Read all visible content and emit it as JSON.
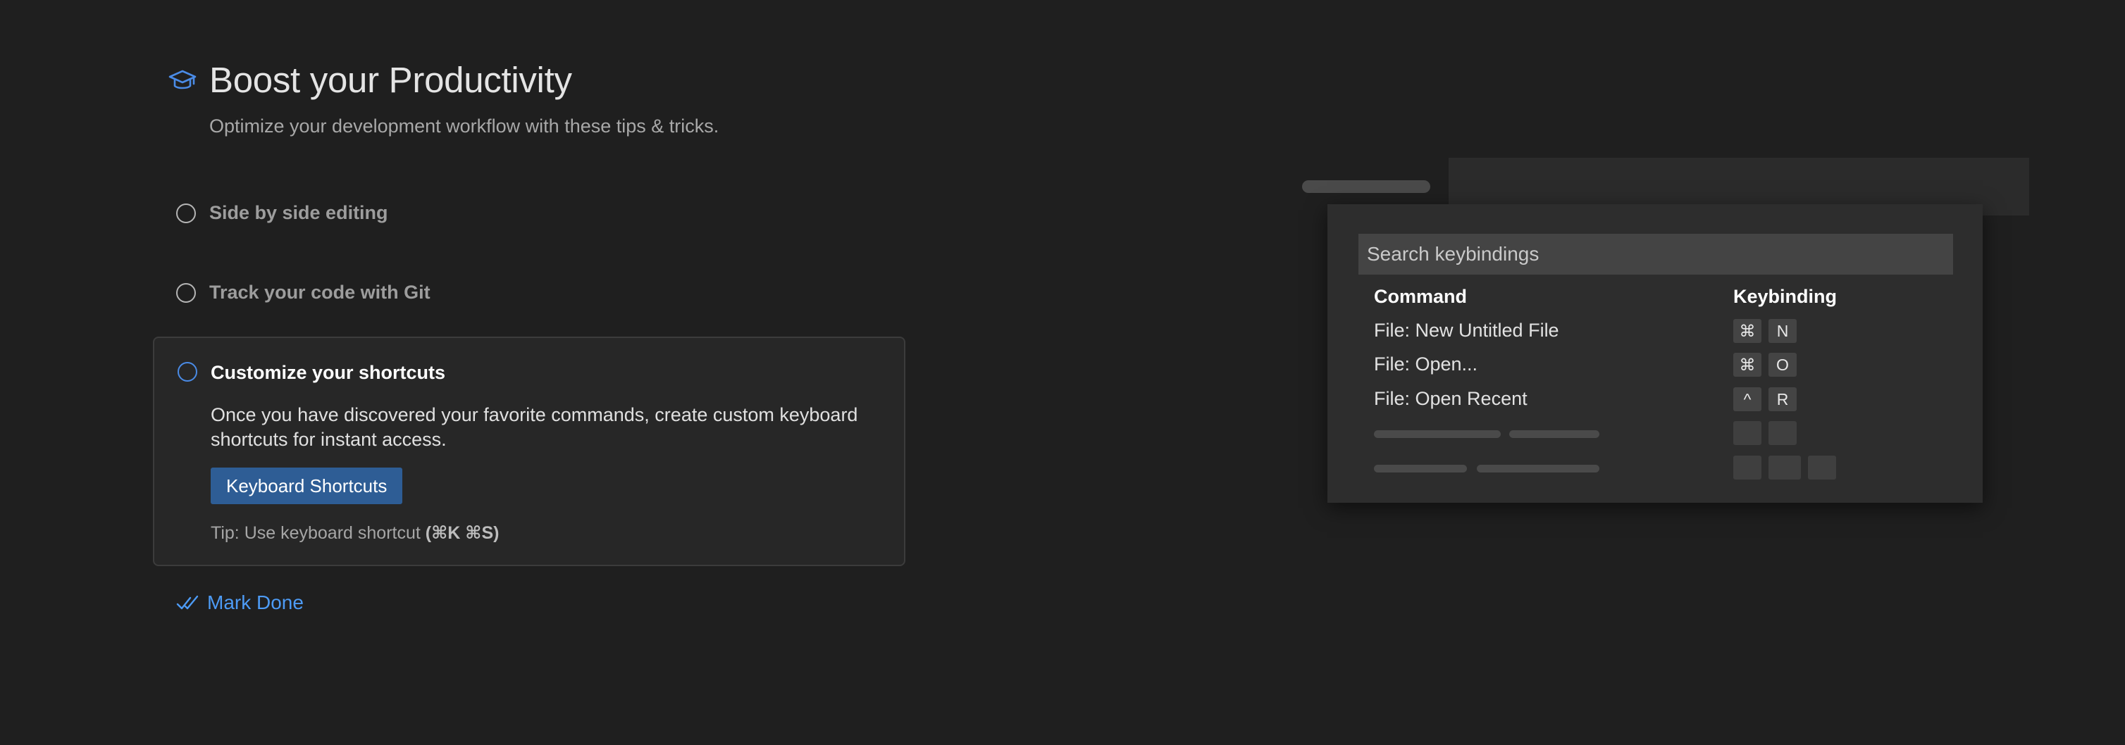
{
  "header": {
    "title": "Boost your Productivity",
    "subtitle": "Optimize your development workflow with these tips & tricks.",
    "icon": "mortarboard-icon"
  },
  "steps": [
    {
      "label": "Side by side editing",
      "checked": false
    },
    {
      "label": "Track your code with Git",
      "checked": false
    }
  ],
  "active_step": {
    "title": "Customize your shortcuts",
    "description": "Once you have discovered your favorite commands, create custom keyboard shortcuts for instant access.",
    "button_label": "Keyboard Shortcuts",
    "tip_prefix": "Tip: Use keyboard shortcut ",
    "tip_shortcut": "(⌘K ⌘S)"
  },
  "mark_done": {
    "label": "Mark Done",
    "icon": "check-all-icon"
  },
  "illustration": {
    "search_placeholder": "Search keybindings",
    "columns": {
      "command": "Command",
      "keybinding": "Keybinding"
    },
    "rows": [
      {
        "command": "File: New Untitled File",
        "keys": [
          "⌘",
          "N"
        ]
      },
      {
        "command": "File: Open...",
        "keys": [
          "⌘",
          "O"
        ]
      },
      {
        "command": "File: Open Recent",
        "keys": [
          "^",
          "R"
        ]
      }
    ]
  },
  "colors": {
    "background": "#1f1f1f",
    "accent": "#4d9bf5",
    "button": "#2e5d95",
    "card": "#272727"
  }
}
